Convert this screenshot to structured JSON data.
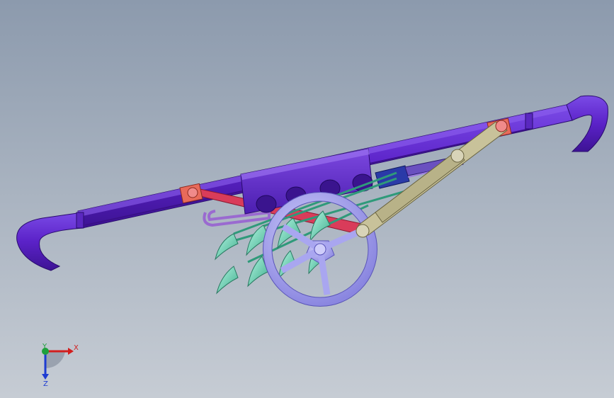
{
  "triad": {
    "x_label": "X",
    "y_label": "Y",
    "z_label": "Z",
    "x_color": "#d21e1e",
    "y_color": "#1ea03c",
    "z_color": "#1e3cd2"
  },
  "colors": {
    "frame": "#5b22c8",
    "frame_dark": "#3f1596",
    "gearbox": "#6a34d6",
    "link_red": "#d93c5a",
    "link_tan": "#c8c29a",
    "tines": "#7fe0c4",
    "wheel": "#a9a6f0",
    "pink_bush": "#e88080"
  }
}
